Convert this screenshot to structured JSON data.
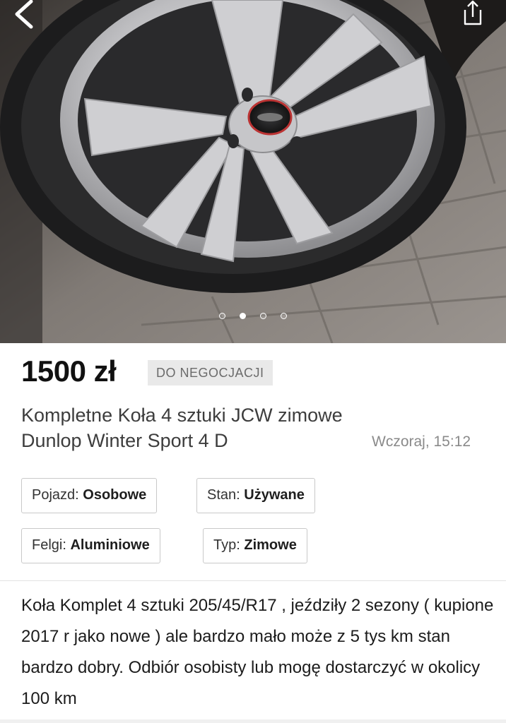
{
  "listing": {
    "price": "1500 zł",
    "negotiable_badge": "DO NEGOCJACJI",
    "title": "Kompletne Koła 4 sztuki JCW zimowe Dunlop Winter Sport 4 D",
    "posted": "Wczoraj, 15:12",
    "attributes": [
      {
        "label": "Pojazd:",
        "value": "Osobowe"
      },
      {
        "label": "Stan:",
        "value": "Używane"
      },
      {
        "label": "Felgi:",
        "value": "Aluminiowe"
      },
      {
        "label": "Typ:",
        "value": "Zimowe"
      }
    ],
    "description": "Koła Komplet 4 sztuki 205/45/R17 ,  jeździły 2 sezony ( kupione 2017 r jako nowe ) ale bardzo mało może z 5 tys km stan bardzo dobry. Odbiór osobisty lub mogę dostarczyć w okolicy 100 km"
  },
  "gallery": {
    "photo_count": 4,
    "active_index": 2
  },
  "nav": {
    "back_icon": "chevron-left-icon",
    "share_icon": "share-icon"
  },
  "colors": {
    "badge_bg": "#e9e9e9",
    "badge_text": "#6b6b6b",
    "chip_border": "#c9c9c9"
  }
}
